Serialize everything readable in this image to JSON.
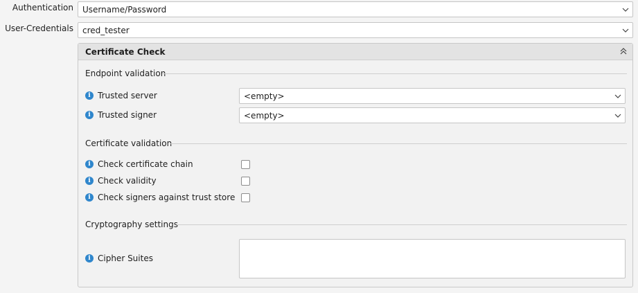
{
  "connection": {
    "authentication_label": "Authentication",
    "authentication_value": "Username/Password",
    "credentials_label": "User-Credentials",
    "credentials_value": "cred_tester"
  },
  "certificate_panel": {
    "title": "Certificate Check",
    "endpoint_section": {
      "title": "Endpoint validation",
      "trusted_server_label": "Trusted server",
      "trusted_server_value": "<empty>",
      "trusted_signer_label": "Trusted signer",
      "trusted_signer_value": "<empty>"
    },
    "certificate_section": {
      "title": "Certificate validation",
      "check_chain_label": "Check certificate chain",
      "check_chain_checked": false,
      "check_validity_label": "Check validity",
      "check_validity_checked": false,
      "check_signers_label": "Check signers against trust store",
      "check_signers_checked": false
    },
    "crypto_section": {
      "title": "Cryptography settings",
      "cipher_suites_label": "Cipher Suites",
      "cipher_suites_value": ""
    }
  },
  "icons": {
    "info": "info-icon",
    "dropdown": "chevron-down-icon",
    "collapse": "double-chevron-up-icon"
  },
  "colors": {
    "info_icon": "#2f86cc",
    "panel_header": "#e3e3e3",
    "background": "#f4f4f4"
  }
}
